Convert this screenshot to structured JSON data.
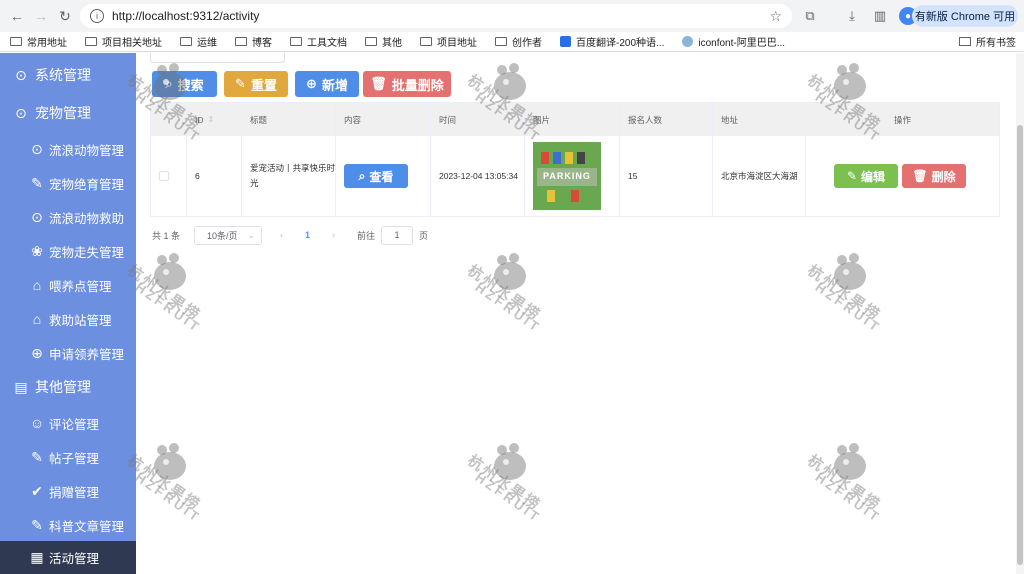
{
  "browser": {
    "url": "http://localhost:9312/activity",
    "update_label": "有新版 Chrome 可用",
    "bookmarks": [
      "常用地址",
      "项目相关地址",
      "运维",
      "博客",
      "工具文档",
      "其他",
      "项目地址",
      "创作者",
      "百度翻译-200种语...",
      "iconfont-阿里巴巴..."
    ],
    "bookmarks_right": "所有书签"
  },
  "sidebar": {
    "items": [
      {
        "label": "系统管理",
        "icon": "ellipsis-circle-icon",
        "type": "group"
      },
      {
        "label": "宠物管理",
        "icon": "ellipsis-circle-icon",
        "type": "group"
      },
      {
        "label": "流浪动物管理",
        "icon": "ellipsis-circle-icon",
        "type": "sub"
      },
      {
        "label": "宠物绝育管理",
        "icon": "edit-icon",
        "type": "sub"
      },
      {
        "label": "流浪动物救助",
        "icon": "ellipsis-circle-icon",
        "type": "sub"
      },
      {
        "label": "宠物走失管理",
        "icon": "paw-icon",
        "type": "sub"
      },
      {
        "label": "喂养点管理",
        "icon": "house-icon",
        "type": "sub"
      },
      {
        "label": "救助站管理",
        "icon": "house-icon",
        "type": "sub"
      },
      {
        "label": "申请领养管理",
        "icon": "plus-circle-icon",
        "type": "sub"
      },
      {
        "label": "其他管理",
        "icon": "book-icon",
        "type": "group"
      },
      {
        "label": "评论管理",
        "icon": "users-icon",
        "type": "sub"
      },
      {
        "label": "帖子管理",
        "icon": "edit-icon",
        "type": "sub"
      },
      {
        "label": "捐赠管理",
        "icon": "check-circle-icon",
        "type": "sub"
      },
      {
        "label": "科普文章管理",
        "icon": "edit-icon",
        "type": "sub"
      },
      {
        "label": "活动管理",
        "icon": "calendar-icon",
        "type": "sub",
        "active": true
      }
    ]
  },
  "toolbar": {
    "search_label": "搜索",
    "reset_label": "重置",
    "add_label": "新增",
    "batch_delete_label": "批量删除"
  },
  "table": {
    "headers": [
      "ID",
      "标题",
      "内容",
      "时间",
      "图片",
      "报名人数",
      "地址",
      "操作"
    ],
    "rows": [
      {
        "id": "6",
        "title": "爱宠活动丨共享快乐时光",
        "content_button": "查看",
        "time": "2023-12-04 13:05:34",
        "image_label": "PARKING",
        "signups": "15",
        "address": "北京市海淀区大海湖",
        "edit_label": "编辑",
        "delete_label": "删除"
      }
    ]
  },
  "pagination": {
    "total": "共 1 条",
    "page_size": "10条/页",
    "current_page": "1",
    "goto_prefix": "前往",
    "goto_value": "1",
    "goto_suffix": "页"
  },
  "watermark": {
    "text_cn": "杭州水果捞",
    "text_en": "HZFRUIT"
  },
  "colors": {
    "sidebar_bg": "#6c8fe0",
    "sidebar_active": "#2f3a52",
    "search_btn": "#4f8ee8",
    "reset_btn": "#e1a83d",
    "add_btn": "#4f8ee8",
    "delete_btn": "#e57070",
    "edit_btn": "#7cc04f"
  }
}
